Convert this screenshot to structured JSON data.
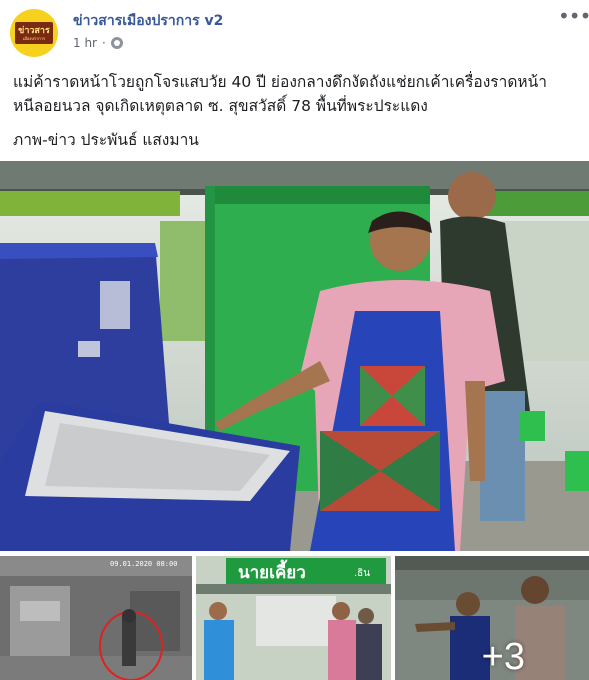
{
  "post": {
    "page_name": "ข่าวสารเมืองปราการ v2",
    "time": "1 hr",
    "privacy_icon": "globe-icon",
    "more_icon": "more-options-icon",
    "text_line1": "แม่ค้าราดหน้าโวยถูกโจรแสบวัย 40 ปี ย่องกลางดึกงัดถังแช่ยกเค้าเครื่องราดหน้า",
    "text_line2": "หนีลอยนวล จุดเกิดเหตุตลาด ซ. สุขสวัสดิ์ 78 พื้นที่พระประแดง",
    "credit": "ภาพ-ข่าว ประพันธ์ แสงมาน"
  },
  "avatar": {
    "logo_main": "ข่าวสาร",
    "logo_sub": "เมืองปราการ",
    "bg_color": "#f6d21f",
    "box_color": "#7a2a12"
  },
  "photos": {
    "sign_text": "นายเคี้ยว",
    "sign_text_2": ".ธิน",
    "thumb1_timestamp": "09.01.2020 08:00",
    "more_count": "+3"
  },
  "colors": {
    "link": "#385898",
    "muted": "#616770"
  }
}
